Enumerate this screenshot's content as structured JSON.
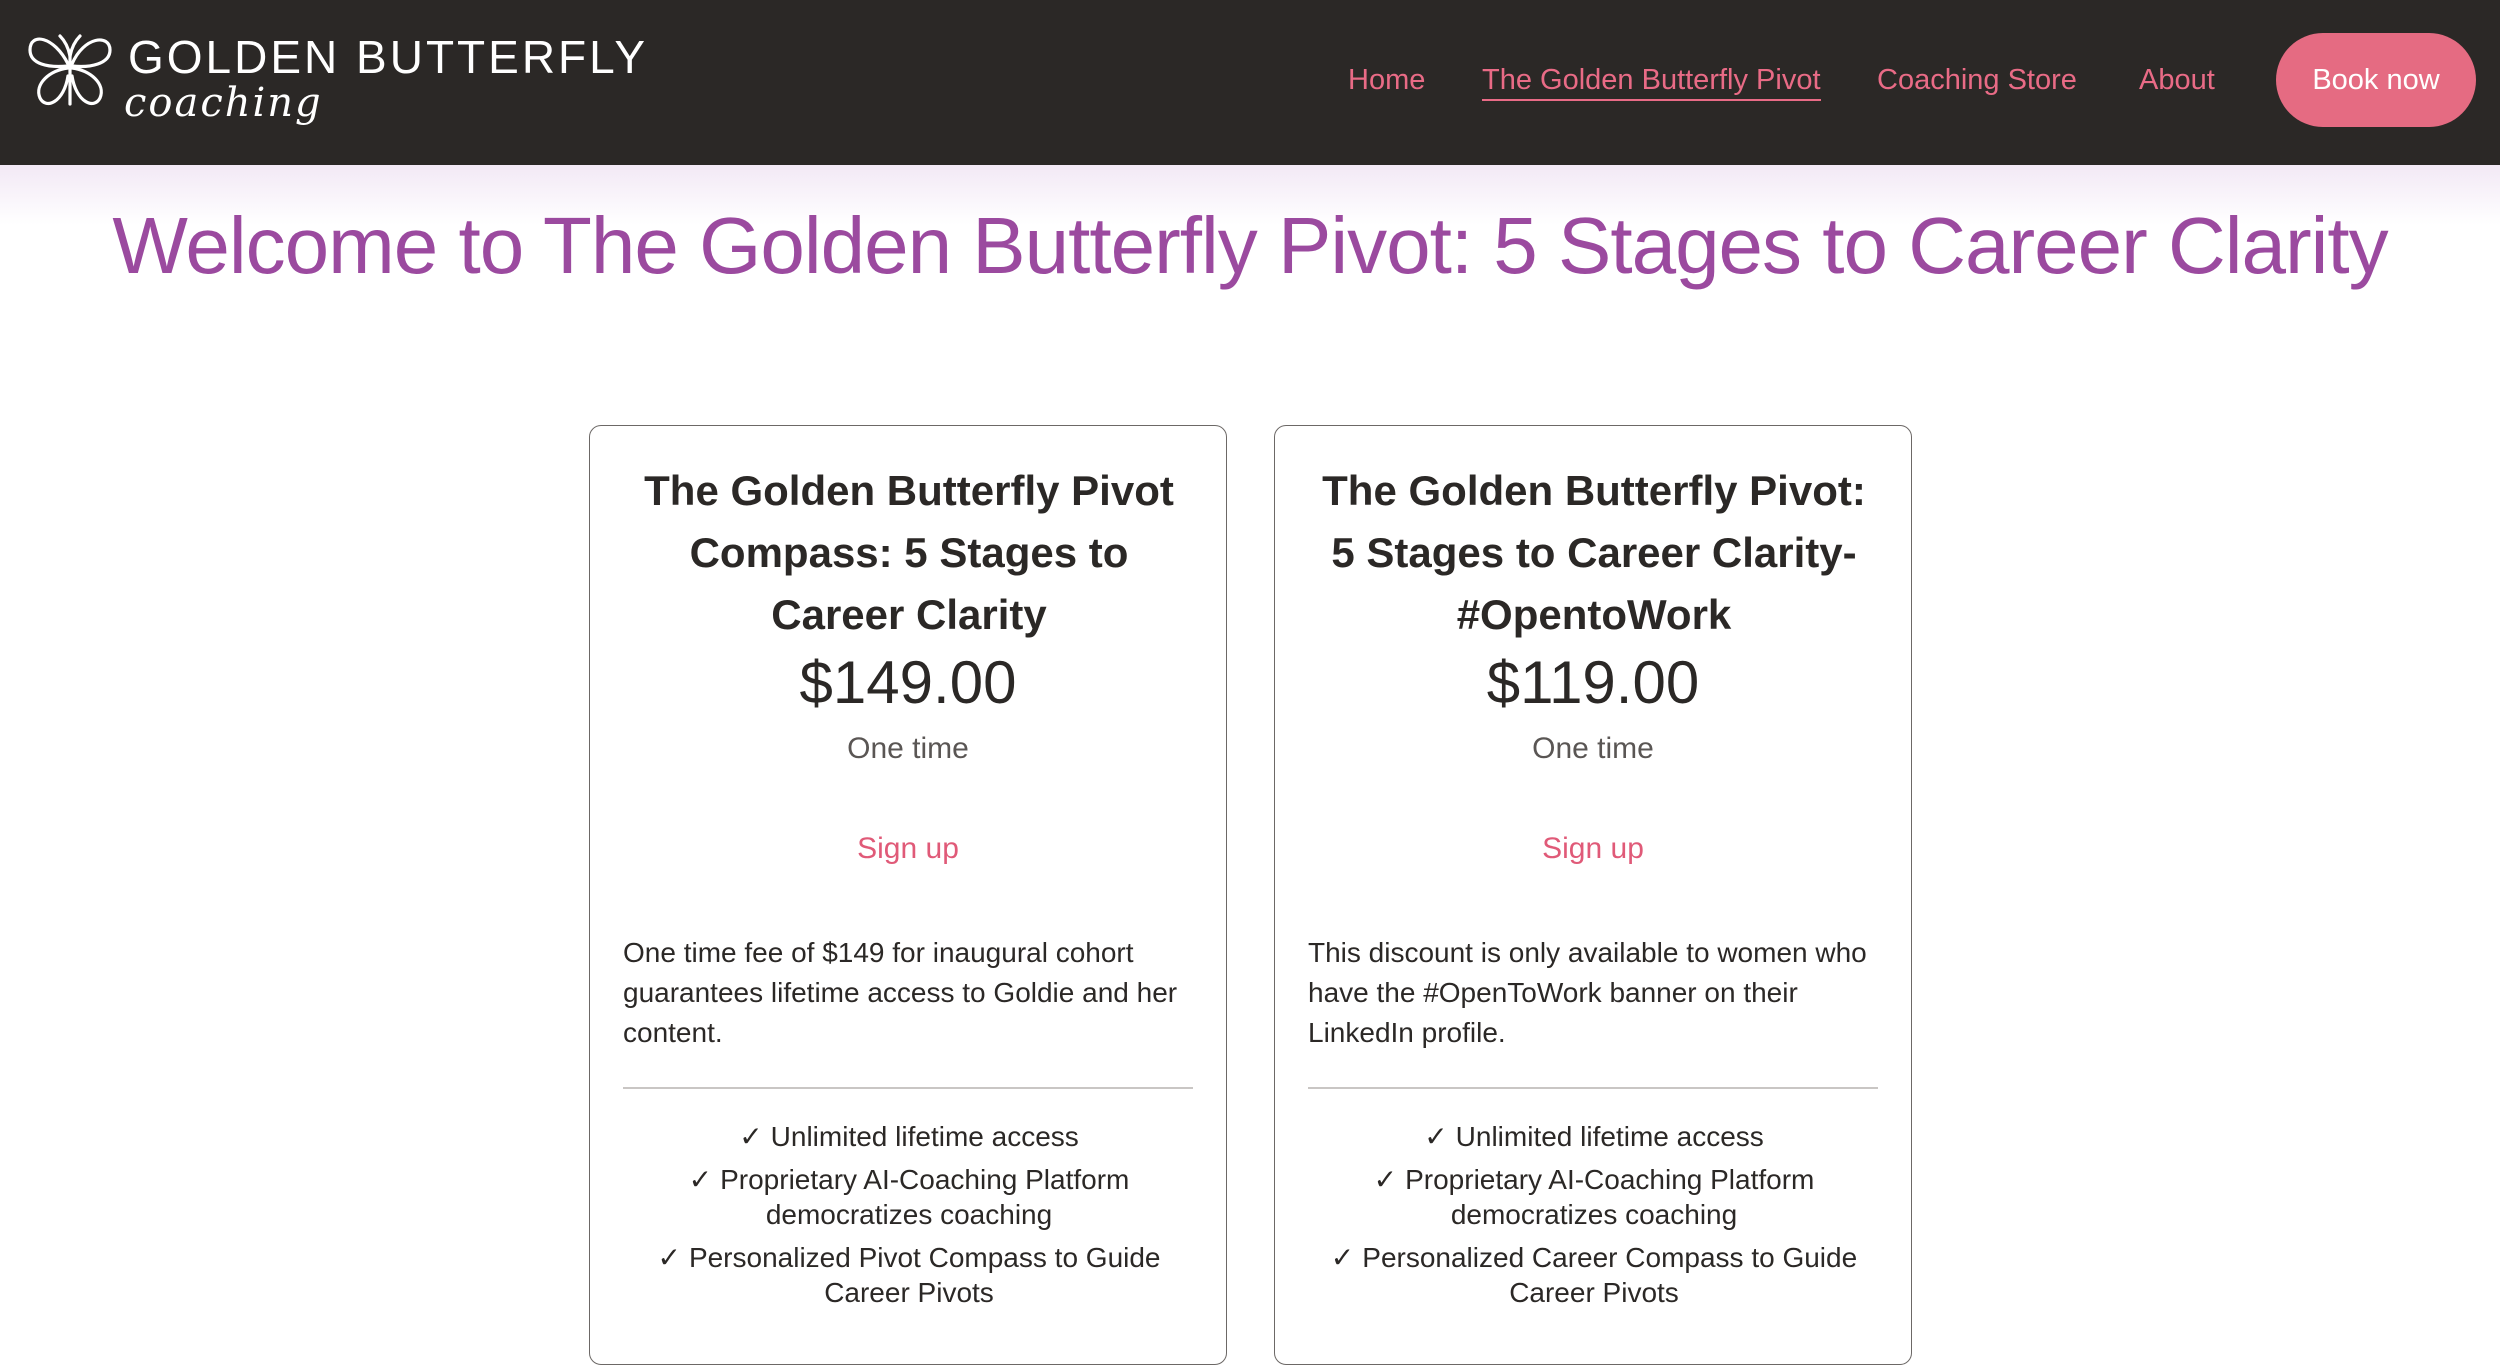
{
  "brand": {
    "title": "GOLDEN BUTTERFLY",
    "subtitle": "coaching",
    "icon": "butterfly-icon"
  },
  "nav": {
    "items": [
      {
        "label": "Home",
        "active": false
      },
      {
        "label": "The Golden Butterfly Pivot",
        "active": true
      },
      {
        "label": "Coaching Store",
        "active": false
      },
      {
        "label": "About",
        "active": false
      }
    ],
    "cta_label": "Book now"
  },
  "colors": {
    "header_bg": "#2b2826",
    "accent_pink": "#e56b82",
    "title_purple": "#9b4a9f"
  },
  "page": {
    "title": "Welcome to The Golden Butterfly Pivot: 5 Stages to Career Clarity"
  },
  "plans": [
    {
      "title": "The Golden Butterfly Pivot Compass: 5 Stages to Career Clarity",
      "price": "$149.00",
      "period": "One time",
      "signup_label": "Sign up",
      "description": "One time fee of $149 for inaugural cohort guarantees lifetime access to Goldie and her content.",
      "features": [
        {
          "check": "✓",
          "text": "Unlimited lifetime access"
        },
        {
          "check": "✓",
          "text": "Proprietary AI-Coaching Platform democratizes coaching"
        },
        {
          "check": "✓",
          "text": "Personalized Pivot Compass to Guide Career Pivots"
        }
      ]
    },
    {
      "title": "The Golden Butterfly Pivot: 5 Stages to Career Clarity- #OpentoWork",
      "price": "$119.00",
      "period": "One time",
      "signup_label": "Sign up",
      "description": "This discount is only available to women who have the #OpenToWork banner on their LinkedIn profile.",
      "features": [
        {
          "check": "✓",
          "text": "Unlimited lifetime access"
        },
        {
          "check": "✓",
          "text": "Proprietary AI-Coaching Platform democratizes coaching"
        },
        {
          "check": "✓",
          "text": "Personalized Career Compass to Guide Career Pivots"
        }
      ]
    }
  ]
}
